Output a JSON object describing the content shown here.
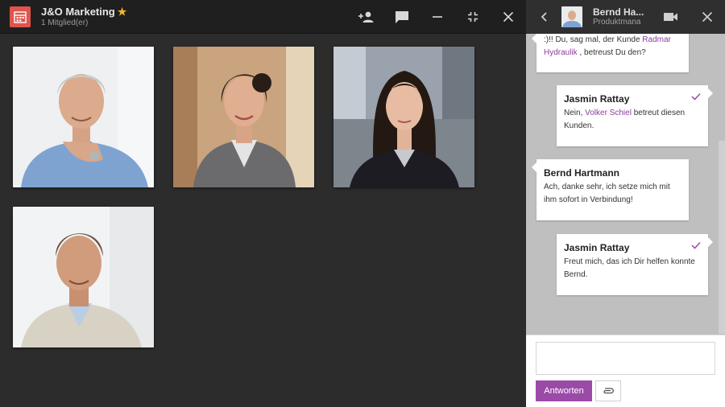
{
  "group": {
    "title": "J&O Marketing",
    "subtitle": "1 Mitglied(er)"
  },
  "icons": {
    "app": "calendar-grid-icon",
    "add_member": "person-add-icon",
    "chat": "chat-icon",
    "minimize": "minimize-icon",
    "collapse": "collapse-icon",
    "close": "close-icon",
    "back": "chevron-left-icon",
    "video": "video-camera-icon",
    "check": "check-icon",
    "attach": "paperclip-icon"
  },
  "colors": {
    "accent": "#9b4aa8",
    "logo": "#e0544b",
    "star": "#f1b726",
    "link": "#8e3c9f"
  },
  "chat": {
    "contact_name": "Bernd Ha...",
    "contact_role": "Produktmana",
    "messages": [
      {
        "direction": "in",
        "text_pre": ":)!! Du, sag mal, der Kunde ",
        "link": "Radmar Hydraulik",
        "text_post": " , betreust Du den?"
      },
      {
        "direction": "out",
        "author": "Jasmin Rattay",
        "text_pre": "Nein, ",
        "link": "Volker Schiel",
        "text_post": " betreut diesen Kunden."
      },
      {
        "direction": "in",
        "author": "Bernd Hartmann",
        "text": "Ach, danke sehr, ich setze mich mit ihm sofort in Verbindung!"
      },
      {
        "direction": "out",
        "author": "Jasmin Rattay",
        "text": "Freut mich, das ich Dir helfen konnte Bernd."
      }
    ]
  },
  "composer": {
    "placeholder": "",
    "reply_label": "Antworten"
  }
}
